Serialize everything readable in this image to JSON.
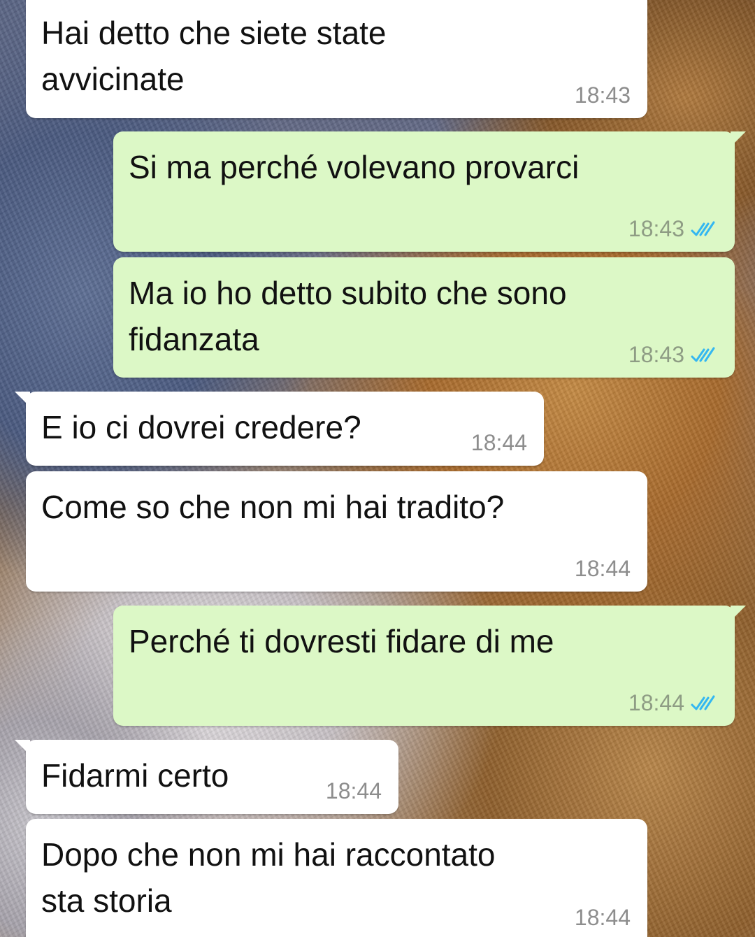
{
  "messages": [
    {
      "direction": "in",
      "text": "Hai detto che siete state\navvicinate",
      "time": "18:43"
    },
    {
      "direction": "out",
      "text": "Si ma perché volevano provarci",
      "time": "18:43",
      "status": "read"
    },
    {
      "direction": "out",
      "text": "Ma io ho detto subito che sono\nfidanzata",
      "time": "18:43",
      "status": "read"
    },
    {
      "direction": "in",
      "text": "E io ci dovrei credere?",
      "time": "18:44"
    },
    {
      "direction": "in",
      "text": "Come so che non mi hai tradito?",
      "time": "18:44"
    },
    {
      "direction": "out",
      "text": "Perché ti dovresti fidare di me",
      "time": "18:44",
      "status": "read"
    },
    {
      "direction": "in",
      "text": "Fidarmi certo",
      "time": "18:44"
    },
    {
      "direction": "in",
      "text": "Dopo che non mi hai raccontato\nsta storia",
      "time": "18:44"
    }
  ],
  "colors": {
    "incoming_bubble": "#ffffff",
    "outgoing_bubble": "#dcf8c6",
    "read_check": "#34b7f1"
  },
  "icons": {
    "read_status": "double-check-icon"
  }
}
